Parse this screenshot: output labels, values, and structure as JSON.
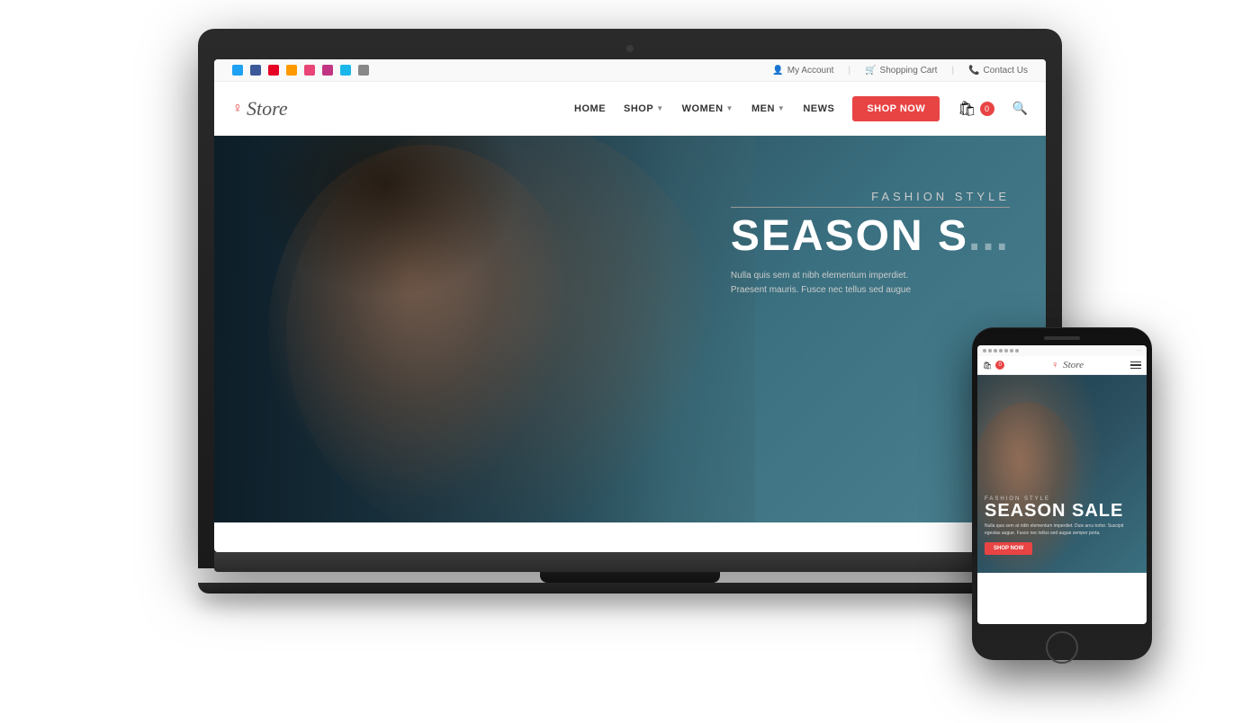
{
  "topbar": {
    "social_icons": [
      "twitter",
      "facebook",
      "pinterest",
      "rss",
      "dribbble",
      "instagram",
      "vimeo",
      "feed"
    ],
    "my_account": "My Account",
    "shopping_cart": "Shopping Cart",
    "contact_us": "Contact Us"
  },
  "navbar": {
    "logo_text": "Store",
    "nav_items": [
      {
        "label": "HOME",
        "has_dropdown": false
      },
      {
        "label": "SHOP",
        "has_dropdown": true
      },
      {
        "label": "WOMEN",
        "has_dropdown": true
      },
      {
        "label": "MEN",
        "has_dropdown": true
      },
      {
        "label": "NEWS",
        "has_dropdown": false
      }
    ],
    "shop_now": "SHOP NOW",
    "cart_count": "0"
  },
  "hero": {
    "fashion_style": "FASHION STYLE",
    "season_sale": "SEASON SALE",
    "description_line1": "Nulla quis sem at nibh elementum imperdiet.",
    "description_line2": "Praesent mauris. Fusce nec tellus sed augue"
  },
  "phone": {
    "logo_text": "Store",
    "cart_count": "0",
    "fashion_style": "FASHION STYLE",
    "season_sale": "SEASON SALE",
    "description": "Nulla quis sem at nibh elementum imperdiet. Duis arcu tortor. Suscipit egestas augue. Fusce nec tellus sed augue semper porta.",
    "shop_now": "SHOP NOW"
  }
}
